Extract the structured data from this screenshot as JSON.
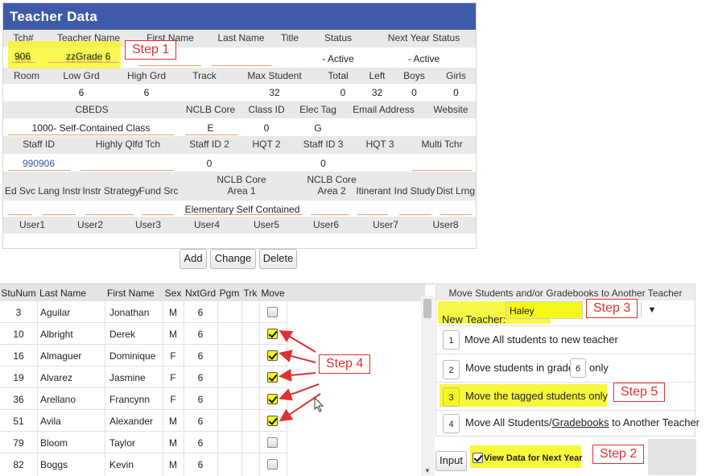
{
  "teacher_panel": {
    "title": "Teacher Data",
    "row1_labels": [
      "Tch#",
      "Teacher Name",
      "First Name",
      "Last Name",
      "Title",
      "Status",
      "Next Year Status"
    ],
    "row1_values": {
      "tch_num": "906",
      "teacher_name": "zzGrade 6",
      "status": "- Active",
      "next_year_status": "- Active"
    },
    "row2_labels": [
      "Room",
      "Low Grd",
      "High Grd",
      "Track",
      "Max Student",
      "Total",
      "Left",
      "Boys",
      "Girls"
    ],
    "row2_values": {
      "low_grd": "6",
      "high_grd": "6",
      "max_student": "32",
      "total": "0",
      "left": "32",
      "boys": "0",
      "girls": "0"
    },
    "row3_labels": [
      "CBEDS",
      "NCLB Core",
      "Class ID",
      "Elec Tag",
      "Email Address",
      "Website"
    ],
    "row3_values": {
      "cbeds": "1000- Self-Contained Class",
      "nclb_core": "E",
      "class_id": "0",
      "elec_tag": "G"
    },
    "row4_labels": [
      "Staff ID",
      "Highly Qlfd Tch",
      "Staff ID 2",
      "HQT 2",
      "Staff ID 3",
      "HQT 3",
      "Multi Tchr"
    ],
    "row4_values": {
      "staff_id": "990906",
      "staff_id_2": "0",
      "staff_id_3": "0"
    },
    "row5_labels": [
      "Ed Svc",
      "Lang Instr",
      "Instr Strategy",
      "Fund Src",
      "NCLB Core Area 1",
      "NCLB Core Area 2",
      "Itinerant",
      "Ind Study",
      "Dist Lrng"
    ],
    "row5_values": {
      "nclb_core_area_1": "Elementary Self Contained"
    },
    "row6_labels": [
      "User1",
      "User2",
      "User3",
      "User4",
      "User5",
      "User6",
      "User7",
      "User8"
    ]
  },
  "buttons": {
    "add": "Add",
    "change": "Change",
    "delete": "Delete",
    "input": "Input"
  },
  "students": {
    "columns": [
      "StuNum",
      "Last Name",
      "First Name",
      "Sex",
      "NxtGrd",
      "Pgm",
      "Trk",
      "Move"
    ],
    "rows": [
      {
        "stunum": "3",
        "last": "Aguilar",
        "first": "Jonathan",
        "sex": "M",
        "grd": "6",
        "move": false
      },
      {
        "stunum": "10",
        "last": "Albright",
        "first": "Derek",
        "sex": "M",
        "grd": "6",
        "move": true
      },
      {
        "stunum": "16",
        "last": "Almaguer",
        "first": "Dominique",
        "sex": "F",
        "grd": "6",
        "move": true
      },
      {
        "stunum": "19",
        "last": "Alvarez",
        "first": "Jasmine",
        "sex": "F",
        "grd": "6",
        "move": true
      },
      {
        "stunum": "36",
        "last": "Arellano",
        "first": "Francynn",
        "sex": "F",
        "grd": "6",
        "move": true
      },
      {
        "stunum": "51",
        "last": "Avila",
        "first": "Alexander",
        "sex": "M",
        "grd": "6",
        "move": true
      },
      {
        "stunum": "79",
        "last": "Bloom",
        "first": "Taylor",
        "sex": "M",
        "grd": "6",
        "move": false
      },
      {
        "stunum": "82",
        "last": "Boggs",
        "first": "Kevin",
        "sex": "M",
        "grd": "6",
        "move": false
      }
    ]
  },
  "move_panel": {
    "title": "Move Students and/or Gradebooks to Another Teacher",
    "new_teacher_label": "New Teacher:",
    "new_teacher_value": "Haley",
    "options": [
      {
        "num": "1",
        "text": "Move All students to new teacher"
      },
      {
        "num": "2",
        "text_before": "Move students in grade",
        "grade": "6",
        "text_after": "only"
      },
      {
        "num": "3",
        "text": "Move the tagged students only"
      },
      {
        "num": "4",
        "text_before": "Move All Students/",
        "link": "Gradebooks",
        "text_after": " to Another Teacher"
      }
    ],
    "view_next_year_label": "View Data for Next Year",
    "view_next_year_checked": true
  },
  "annotations": {
    "step1": "Step 1",
    "step2": "Step 2",
    "step3": "Step 3",
    "step4": "Step 4",
    "step5": "Step 5"
  },
  "colors": {
    "header": "#3f5aa8",
    "highlight": "#f6f61a",
    "annotation": "#e03030"
  }
}
